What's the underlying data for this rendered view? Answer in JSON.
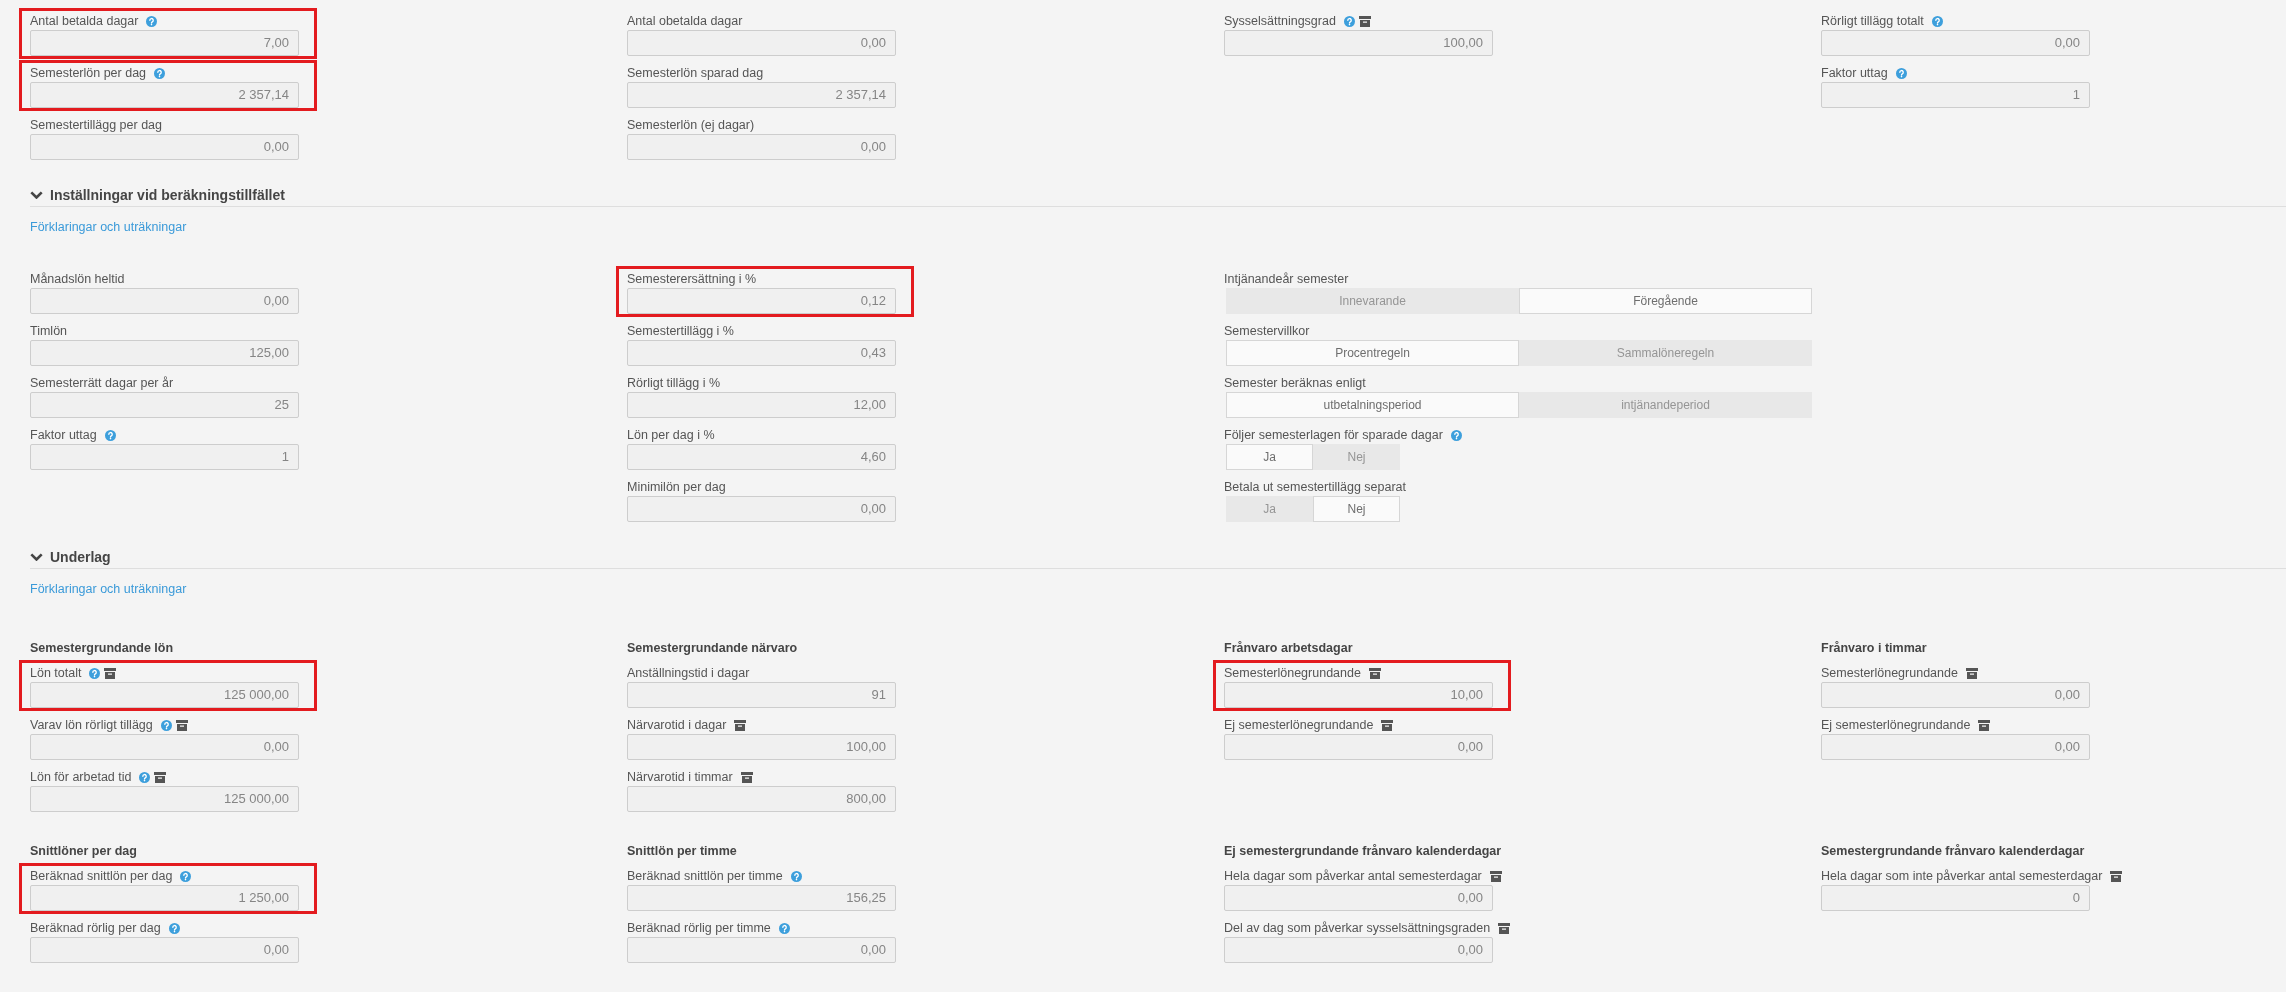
{
  "sections": [
    {
      "rows": [
        {
          "cells": [
            {
              "items": [
                {
                  "kind": "field",
                  "label": "Antal betalda dagar",
                  "icons": [
                    {
                      "kind": "help"
                    }
                  ],
                  "value": "7,00",
                  "highlighted": true
                },
                {
                  "kind": "field",
                  "label": "Semesterlön per dag",
                  "icons": [
                    {
                      "kind": "help"
                    }
                  ],
                  "value": "2 357,14",
                  "highlighted": true
                },
                {
                  "kind": "field",
                  "label": "Semestertillägg per dag",
                  "value": "0,00",
                  "highlighted": false
                }
              ]
            },
            {
              "items": [
                {
                  "kind": "field",
                  "label": "Antal obetalda dagar",
                  "value": "0,00",
                  "highlighted": false
                },
                {
                  "kind": "field",
                  "label": "Semesterlön sparad dag",
                  "value": "2 357,14",
                  "highlighted": false
                },
                {
                  "kind": "field",
                  "label": "Semesterlön (ej dagar)",
                  "value": "0,00",
                  "highlighted": false
                }
              ]
            },
            {
              "items": [
                {
                  "kind": "field",
                  "label": "Sysselsättningsgrad",
                  "icons": [
                    {
                      "kind": "help"
                    },
                    {
                      "kind": "archive"
                    }
                  ],
                  "value": "100,00",
                  "highlighted": false
                }
              ]
            },
            {
              "items": [
                {
                  "kind": "field",
                  "label": "Rörligt tillägg totalt",
                  "icons": [
                    {
                      "kind": "help"
                    }
                  ],
                  "value": "0,00",
                  "highlighted": false
                },
                {
                  "kind": "field",
                  "label": "Faktor uttag",
                  "icons": [
                    {
                      "kind": "help"
                    }
                  ],
                  "value": "1",
                  "highlighted": false
                }
              ]
            }
          ]
        }
      ]
    },
    {
      "title": "Inställningar vid beräkningstillfället",
      "expanded": true,
      "link": "Förklaringar och uträkningar",
      "rows": [
        {
          "cells": [
            {
              "items": [
                {
                  "kind": "field",
                  "label": "Månadslön heltid",
                  "value": "0,00",
                  "highlighted": false
                },
                {
                  "kind": "field",
                  "label": "Timlön",
                  "value": "125,00",
                  "highlighted": false
                },
                {
                  "kind": "field",
                  "label": "Semesterrätt dagar per år",
                  "value": "25",
                  "highlighted": false
                },
                {
                  "kind": "field",
                  "label": "Faktor uttag",
                  "icons": [
                    {
                      "kind": "help"
                    }
                  ],
                  "value": "1",
                  "highlighted": false
                }
              ]
            },
            {
              "items": [
                {
                  "kind": "field",
                  "label": "Semesterersättning i %",
                  "value": "0,12",
                  "highlighted": true
                },
                {
                  "kind": "field",
                  "label": "Semestertillägg i %",
                  "value": "0,43",
                  "highlighted": false
                },
                {
                  "kind": "field",
                  "label": "Rörligt tillägg i %",
                  "value": "12,00",
                  "highlighted": false
                },
                {
                  "kind": "field",
                  "label": "Lön per dag i %",
                  "value": "4,60",
                  "highlighted": false
                },
                {
                  "kind": "field",
                  "label": "Minimilön per dag",
                  "value": "0,00",
                  "highlighted": false
                }
              ]
            },
            {
              "items": [
                {
                  "kind": "choice",
                  "label": "Intjänandeår semester",
                  "options": [
                    {
                      "label": "Innevarande",
                      "selected": false
                    },
                    {
                      "label": "Föregående",
                      "selected": true
                    }
                  ],
                  "highlighted": false
                },
                {
                  "kind": "choice",
                  "label": "Semestervillkor",
                  "options": [
                    {
                      "label": "Procentregeln",
                      "selected": true
                    },
                    {
                      "label": "Sammalöneregeln",
                      "selected": false
                    }
                  ],
                  "highlighted": false
                },
                {
                  "kind": "choice",
                  "label": "Semester beräknas enligt",
                  "options": [
                    {
                      "label": "utbetalningsperiod",
                      "selected": true
                    },
                    {
                      "label": "intjänandeperiod",
                      "selected": false
                    }
                  ],
                  "highlighted": false
                },
                {
                  "kind": "yesno",
                  "label": "Följer semesterlagen för sparade dagar",
                  "icons": [
                    {
                      "kind": "help"
                    }
                  ],
                  "options": [
                    {
                      "label": "Ja",
                      "selected": true
                    },
                    {
                      "label": "Nej",
                      "selected": false
                    }
                  ],
                  "highlighted": false
                },
                {
                  "kind": "yesno",
                  "label": "Betala ut semestertillägg separat",
                  "options": [
                    {
                      "label": "Ja",
                      "selected": false
                    },
                    {
                      "label": "Nej",
                      "selected": true
                    }
                  ],
                  "highlighted": false
                }
              ]
            }
          ]
        }
      ]
    },
    {
      "title": "Underlag",
      "expanded": true,
      "link": "Förklaringar och uträkningar",
      "rows": [
        {
          "cells": [
            {
              "title": "Semestergrundande lön",
              "items": [
                {
                  "kind": "field",
                  "label": "Lön totalt",
                  "icons": [
                    {
                      "kind": "help"
                    },
                    {
                      "kind": "archive"
                    }
                  ],
                  "value": "125 000,00",
                  "highlighted": true
                },
                {
                  "kind": "field",
                  "label": "Varav lön rörligt tillägg",
                  "icons": [
                    {
                      "kind": "help"
                    },
                    {
                      "kind": "archive"
                    }
                  ],
                  "value": "0,00",
                  "highlighted": false
                },
                {
                  "kind": "field",
                  "label": "Lön för arbetad tid",
                  "icons": [
                    {
                      "kind": "help"
                    },
                    {
                      "kind": "archive"
                    }
                  ],
                  "value": "125 000,00",
                  "highlighted": false
                }
              ]
            },
            {
              "title": "Semestergrundande närvaro",
              "items": [
                {
                  "kind": "field",
                  "label": "Anställningstid i dagar",
                  "value": "91",
                  "highlighted": false
                },
                {
                  "kind": "field",
                  "label": "Närvarotid i dagar",
                  "icons": [
                    {
                      "kind": "archive"
                    }
                  ],
                  "value": "100,00",
                  "highlighted": false
                },
                {
                  "kind": "field",
                  "label": "Närvarotid i timmar",
                  "icons": [
                    {
                      "kind": "archive"
                    }
                  ],
                  "value": "800,00",
                  "highlighted": false
                }
              ]
            },
            {
              "title": "Frånvaro arbetsdagar",
              "items": [
                {
                  "kind": "field",
                  "label": "Semesterlönegrundande",
                  "icons": [
                    {
                      "kind": "archive"
                    }
                  ],
                  "value": "10,00",
                  "highlighted": true
                },
                {
                  "kind": "field",
                  "label": "Ej semesterlönegrundande",
                  "icons": [
                    {
                      "kind": "archive"
                    }
                  ],
                  "value": "0,00",
                  "highlighted": false
                }
              ]
            },
            {
              "title": "Frånvaro i timmar",
              "items": [
                {
                  "kind": "field",
                  "label": "Semesterlönegrundande",
                  "icons": [
                    {
                      "kind": "archive"
                    }
                  ],
                  "value": "0,00",
                  "highlighted": false
                },
                {
                  "kind": "field",
                  "label": "Ej semesterlönegrundande",
                  "icons": [
                    {
                      "kind": "archive"
                    }
                  ],
                  "value": "0,00",
                  "highlighted": false
                }
              ]
            }
          ]
        },
        {
          "cells": [
            {
              "title": "Snittlöner per dag",
              "items": [
                {
                  "kind": "field",
                  "label": "Beräknad snittlön per dag",
                  "icons": [
                    {
                      "kind": "help"
                    }
                  ],
                  "value": "1 250,00",
                  "highlighted": true
                },
                {
                  "kind": "field",
                  "label": "Beräknad rörlig per dag",
                  "icons": [
                    {
                      "kind": "help"
                    }
                  ],
                  "value": "0,00",
                  "highlighted": false
                }
              ]
            },
            {
              "title": "Snittlön per timme",
              "items": [
                {
                  "kind": "field",
                  "label": "Beräknad snittlön per timme",
                  "icons": [
                    {
                      "kind": "help"
                    }
                  ],
                  "value": "156,25",
                  "highlighted": false
                },
                {
                  "kind": "field",
                  "label": "Beräknad rörlig per timme",
                  "icons": [
                    {
                      "kind": "help"
                    }
                  ],
                  "value": "0,00",
                  "highlighted": false
                }
              ]
            },
            {
              "title": "Ej semestergrundande frånvaro kalenderdagar",
              "items": [
                {
                  "kind": "field",
                  "label": "Hela dagar som påverkar antal semesterdagar",
                  "icons": [
                    {
                      "kind": "archive"
                    }
                  ],
                  "value": "0,00",
                  "highlighted": false
                },
                {
                  "kind": "field",
                  "label": "Del av dag som påverkar sysselsättningsgraden",
                  "icons": [
                    {
                      "kind": "archive"
                    }
                  ],
                  "value": "0,00",
                  "highlighted": false
                }
              ]
            },
            {
              "title": "Semestergrundande frånvaro kalenderdagar",
              "items": [
                {
                  "kind": "field",
                  "label": "Hela dagar som inte påverkar antal semesterdagar",
                  "icons": [
                    {
                      "kind": "archive"
                    }
                  ],
                  "value": "0",
                  "highlighted": false
                }
              ]
            }
          ]
        }
      ]
    }
  ]
}
